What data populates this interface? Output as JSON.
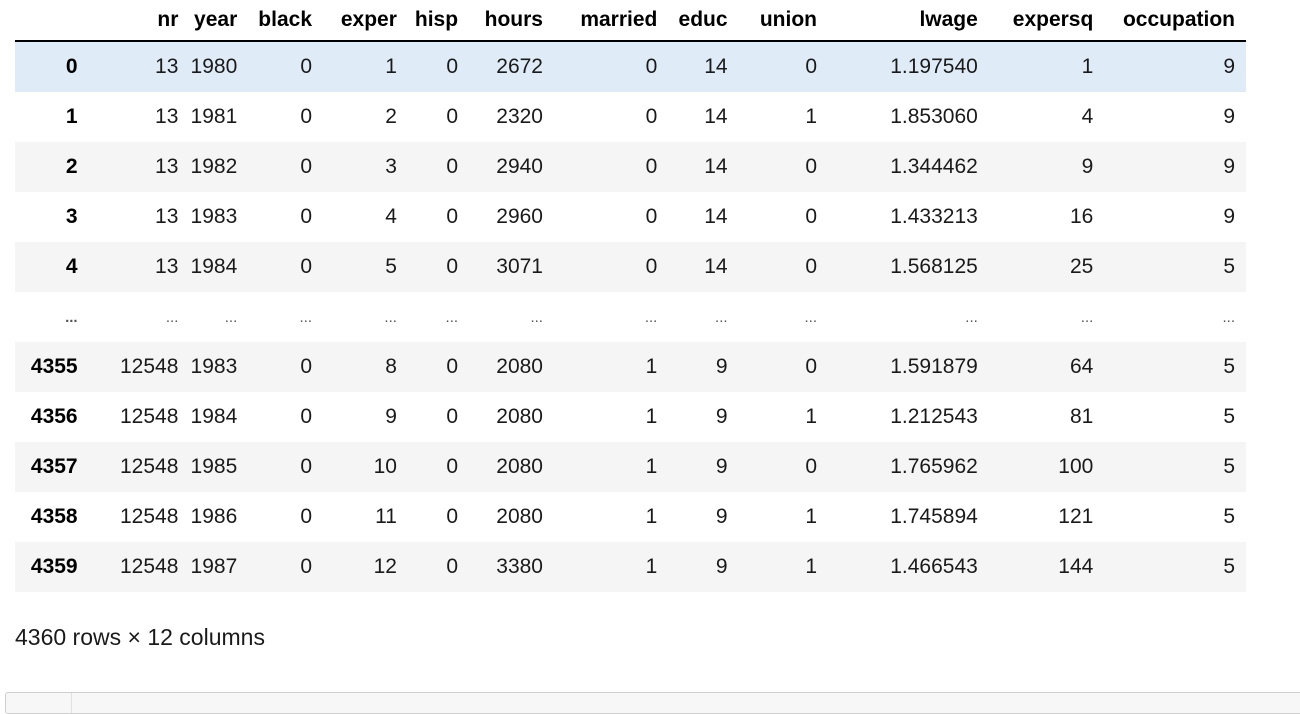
{
  "table": {
    "columns": [
      "",
      "nr",
      "year",
      "black",
      "exper",
      "hisp",
      "hours",
      "married",
      "educ",
      "union",
      "lwage",
      "expersq",
      "occupation"
    ],
    "rows": [
      [
        "0",
        "13",
        "1980",
        "0",
        "1",
        "0",
        "2672",
        "0",
        "14",
        "0",
        "1.197540",
        "1",
        "9"
      ],
      [
        "1",
        "13",
        "1981",
        "0",
        "2",
        "0",
        "2320",
        "0",
        "14",
        "1",
        "1.853060",
        "4",
        "9"
      ],
      [
        "2",
        "13",
        "1982",
        "0",
        "3",
        "0",
        "2940",
        "0",
        "14",
        "0",
        "1.344462",
        "9",
        "9"
      ],
      [
        "3",
        "13",
        "1983",
        "0",
        "4",
        "0",
        "2960",
        "0",
        "14",
        "0",
        "1.433213",
        "16",
        "9"
      ],
      [
        "4",
        "13",
        "1984",
        "0",
        "5",
        "0",
        "3071",
        "0",
        "14",
        "0",
        "1.568125",
        "25",
        "5"
      ],
      [
        "...",
        "...",
        "...",
        "...",
        "...",
        "...",
        "...",
        "...",
        "...",
        "...",
        "...",
        "...",
        "..."
      ],
      [
        "4355",
        "12548",
        "1983",
        "0",
        "8",
        "0",
        "2080",
        "1",
        "9",
        "0",
        "1.591879",
        "64",
        "5"
      ],
      [
        "4356",
        "12548",
        "1984",
        "0",
        "9",
        "0",
        "2080",
        "1",
        "9",
        "1",
        "1.212543",
        "81",
        "5"
      ],
      [
        "4357",
        "12548",
        "1985",
        "0",
        "10",
        "0",
        "2080",
        "1",
        "9",
        "0",
        "1.765962",
        "100",
        "5"
      ],
      [
        "4358",
        "12548",
        "1986",
        "0",
        "11",
        "0",
        "2080",
        "1",
        "9",
        "1",
        "1.745894",
        "121",
        "5"
      ],
      [
        "4359",
        "12548",
        "1987",
        "0",
        "12",
        "0",
        "3380",
        "1",
        "9",
        "1",
        "1.466543",
        "144",
        "5"
      ]
    ],
    "highlighted_row": 0
  },
  "shape_text": "4360 rows × 12 columns",
  "colors": {
    "highlight": "#dfecf8",
    "stripe": "#f5f5f5",
    "header_rule": "#000000"
  }
}
